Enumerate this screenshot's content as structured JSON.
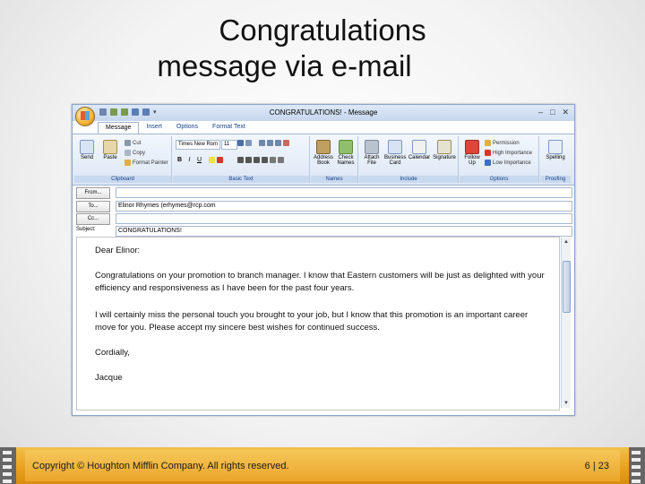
{
  "slide": {
    "title_line1": "Congratulations",
    "title_line2": "message via e-mail",
    "copyright": "Copyright © Houghton Mifflin Company. All rights reserved.",
    "page": "6 | 23"
  },
  "window": {
    "title": "CONGRATULATIONS! - Message",
    "minimize": "–",
    "maximize": "□",
    "close": "✕"
  },
  "ribbon": {
    "tabs": [
      "Message",
      "Insert",
      "Options",
      "Format Text"
    ],
    "clipboard": {
      "send": "Send",
      "paste": "Paste",
      "cut": "Cut",
      "copy": "Copy",
      "format_painter": "Format Painter",
      "label": "Clipboard"
    },
    "basic_text": {
      "font": "Times New Rom",
      "size": "11",
      "bold": "B",
      "italic": "I",
      "underline": "U",
      "label": "Basic Text"
    },
    "names": {
      "address_book": "Address Book",
      "check_names": "Check Names",
      "label": "Names"
    },
    "include": {
      "attach_file": "Attach File",
      "business_card": "Business Card",
      "calendar": "Calendar",
      "signature": "Signature",
      "label": "Include"
    },
    "options": {
      "follow_up": "Follow Up",
      "permission": "Permission",
      "high_importance": "High Importance",
      "low_importance": "Low Importance",
      "label": "Options"
    },
    "proofing": {
      "spelling": "Spelling",
      "label": "Proofing"
    }
  },
  "headers": {
    "from_label": "From...",
    "from_value": "",
    "to_label": "To...",
    "to_value": "Elinor Rhymes (erhymes@rcp.com",
    "cc_label": "Cc...",
    "cc_value": "",
    "subject_label": "Subject:",
    "subject_value": "CONGRATULATIONS!"
  },
  "message": {
    "greeting": "Dear Elinor:",
    "para1": "Congratulations on your promotion to branch manager. I know that Eastern customers will be just as delighted with your efficiency and responsiveness as I have been for the past four years.",
    "para2": "I will certainly miss the personal touch you brought to your job, but I know that this promotion is an important career move for you. Please accept my sincere best wishes for continued success.",
    "closing": "Cordially,",
    "signature": "Jacque"
  },
  "colors": {
    "footer_gold": "#e9a21e",
    "ribbon_blue": "#15428b"
  }
}
